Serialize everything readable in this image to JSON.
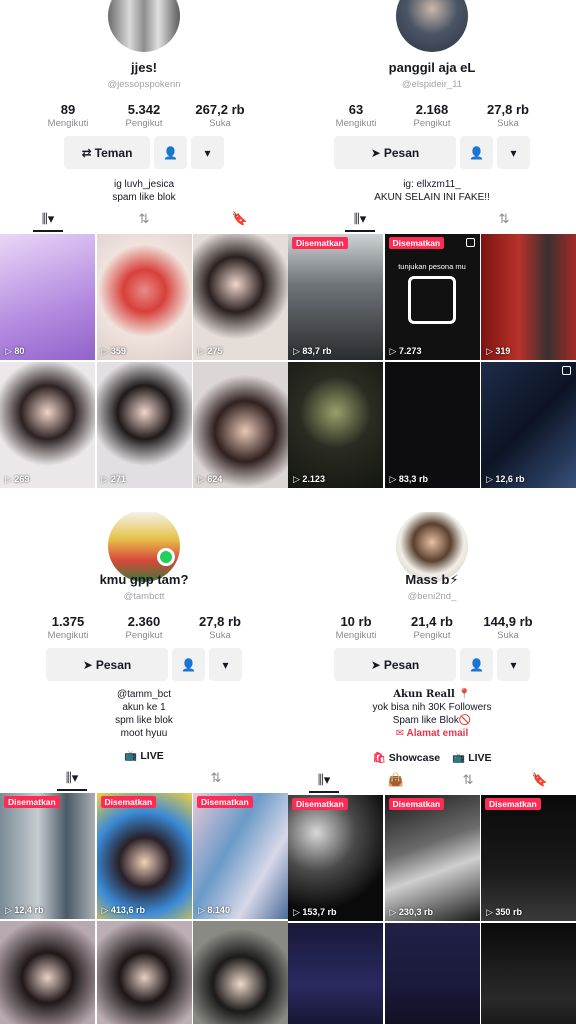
{
  "profiles": [
    {
      "name": "jjes!",
      "handle": "@jessopspokenn",
      "stats": [
        {
          "num": "89",
          "lbl": "Mengikuti"
        },
        {
          "num": "5.342",
          "lbl": "Pengikut"
        },
        {
          "num": "267,2 rb",
          "lbl": "Suka"
        }
      ],
      "primary_button": "Teman",
      "bio": [
        "ig luvh_jesica",
        "spam like blok"
      ],
      "tiles": [
        {
          "views": "80",
          "pinned": ""
        },
        {
          "views": "359",
          "pinned": ""
        },
        {
          "views": "275",
          "pinned": ""
        },
        {
          "views": "269",
          "pinned": ""
        },
        {
          "views": "271",
          "pinned": ""
        },
        {
          "views": "624",
          "pinned": ""
        }
      ]
    },
    {
      "name": "panggil aja eL",
      "handle": "@elspideir_11",
      "stats": [
        {
          "num": "63",
          "lbl": "Mengikuti"
        },
        {
          "num": "2.168",
          "lbl": "Pengikut"
        },
        {
          "num": "27,8 rb",
          "lbl": "Suka"
        }
      ],
      "primary_button": "Pesan",
      "bio": [
        "ig: ellxzm11_",
        "AKUN SELAIN INI FAKE!!"
      ],
      "tiles": [
        {
          "views": "83,7 rb",
          "pinned": "Disematkan"
        },
        {
          "views": "7.273",
          "pinned": "Disematkan",
          "caption": "tunjukan pesona mu"
        },
        {
          "views": "319",
          "pinned": ""
        },
        {
          "views": "2.123",
          "pinned": ""
        },
        {
          "views": "83,3 rb",
          "pinned": ""
        },
        {
          "views": "12,6 rb",
          "pinned": ""
        }
      ]
    },
    {
      "name": "kmu gpp tam?",
      "handle": "@tambctt",
      "stats": [
        {
          "num": "1.375",
          "lbl": "Mengikuti"
        },
        {
          "num": "2.360",
          "lbl": "Pengikut"
        },
        {
          "num": "27,8 rb",
          "lbl": "Suka"
        }
      ],
      "primary_button": "Pesan",
      "bio": [
        "@tamm_bct",
        "akun ke 1",
        "spm like blok",
        "moot hyuu"
      ],
      "live_label": "LIVE",
      "tiles": [
        {
          "views": "12,4 rb",
          "pinned": "Disematkan"
        },
        {
          "views": "413,6 rb",
          "pinned": "Disematkan"
        },
        {
          "views": "8.140",
          "pinned": "Disematkan"
        },
        {
          "views": "",
          "pinned": ""
        },
        {
          "views": "",
          "pinned": ""
        },
        {
          "views": "",
          "pinned": ""
        }
      ]
    },
    {
      "name": "Mass b⚡",
      "handle": "@beni2nd_",
      "stats": [
        {
          "num": "10 rb",
          "lbl": "Mengikuti"
        },
        {
          "num": "21,4 rb",
          "lbl": "Pengikut"
        },
        {
          "num": "144,9 rb",
          "lbl": "Suka"
        }
      ],
      "primary_button": "Pesan",
      "bio": [
        "Akun Reall 📍",
        "yok bisa nih 30K Followers",
        "Spam like Blok🚫"
      ],
      "email_label": "Alamat email",
      "showcase_label": "Showcase",
      "live_label": "LIVE",
      "tiles": [
        {
          "views": "153,7 rb",
          "pinned": "Disematkan"
        },
        {
          "views": "230,3 rb",
          "pinned": "Disematkan"
        },
        {
          "views": "350 rb",
          "pinned": "Disematkan"
        },
        {
          "views": "",
          "pinned": ""
        },
        {
          "views": "",
          "pinned": ""
        },
        {
          "views": "",
          "pinned": ""
        }
      ]
    }
  ]
}
